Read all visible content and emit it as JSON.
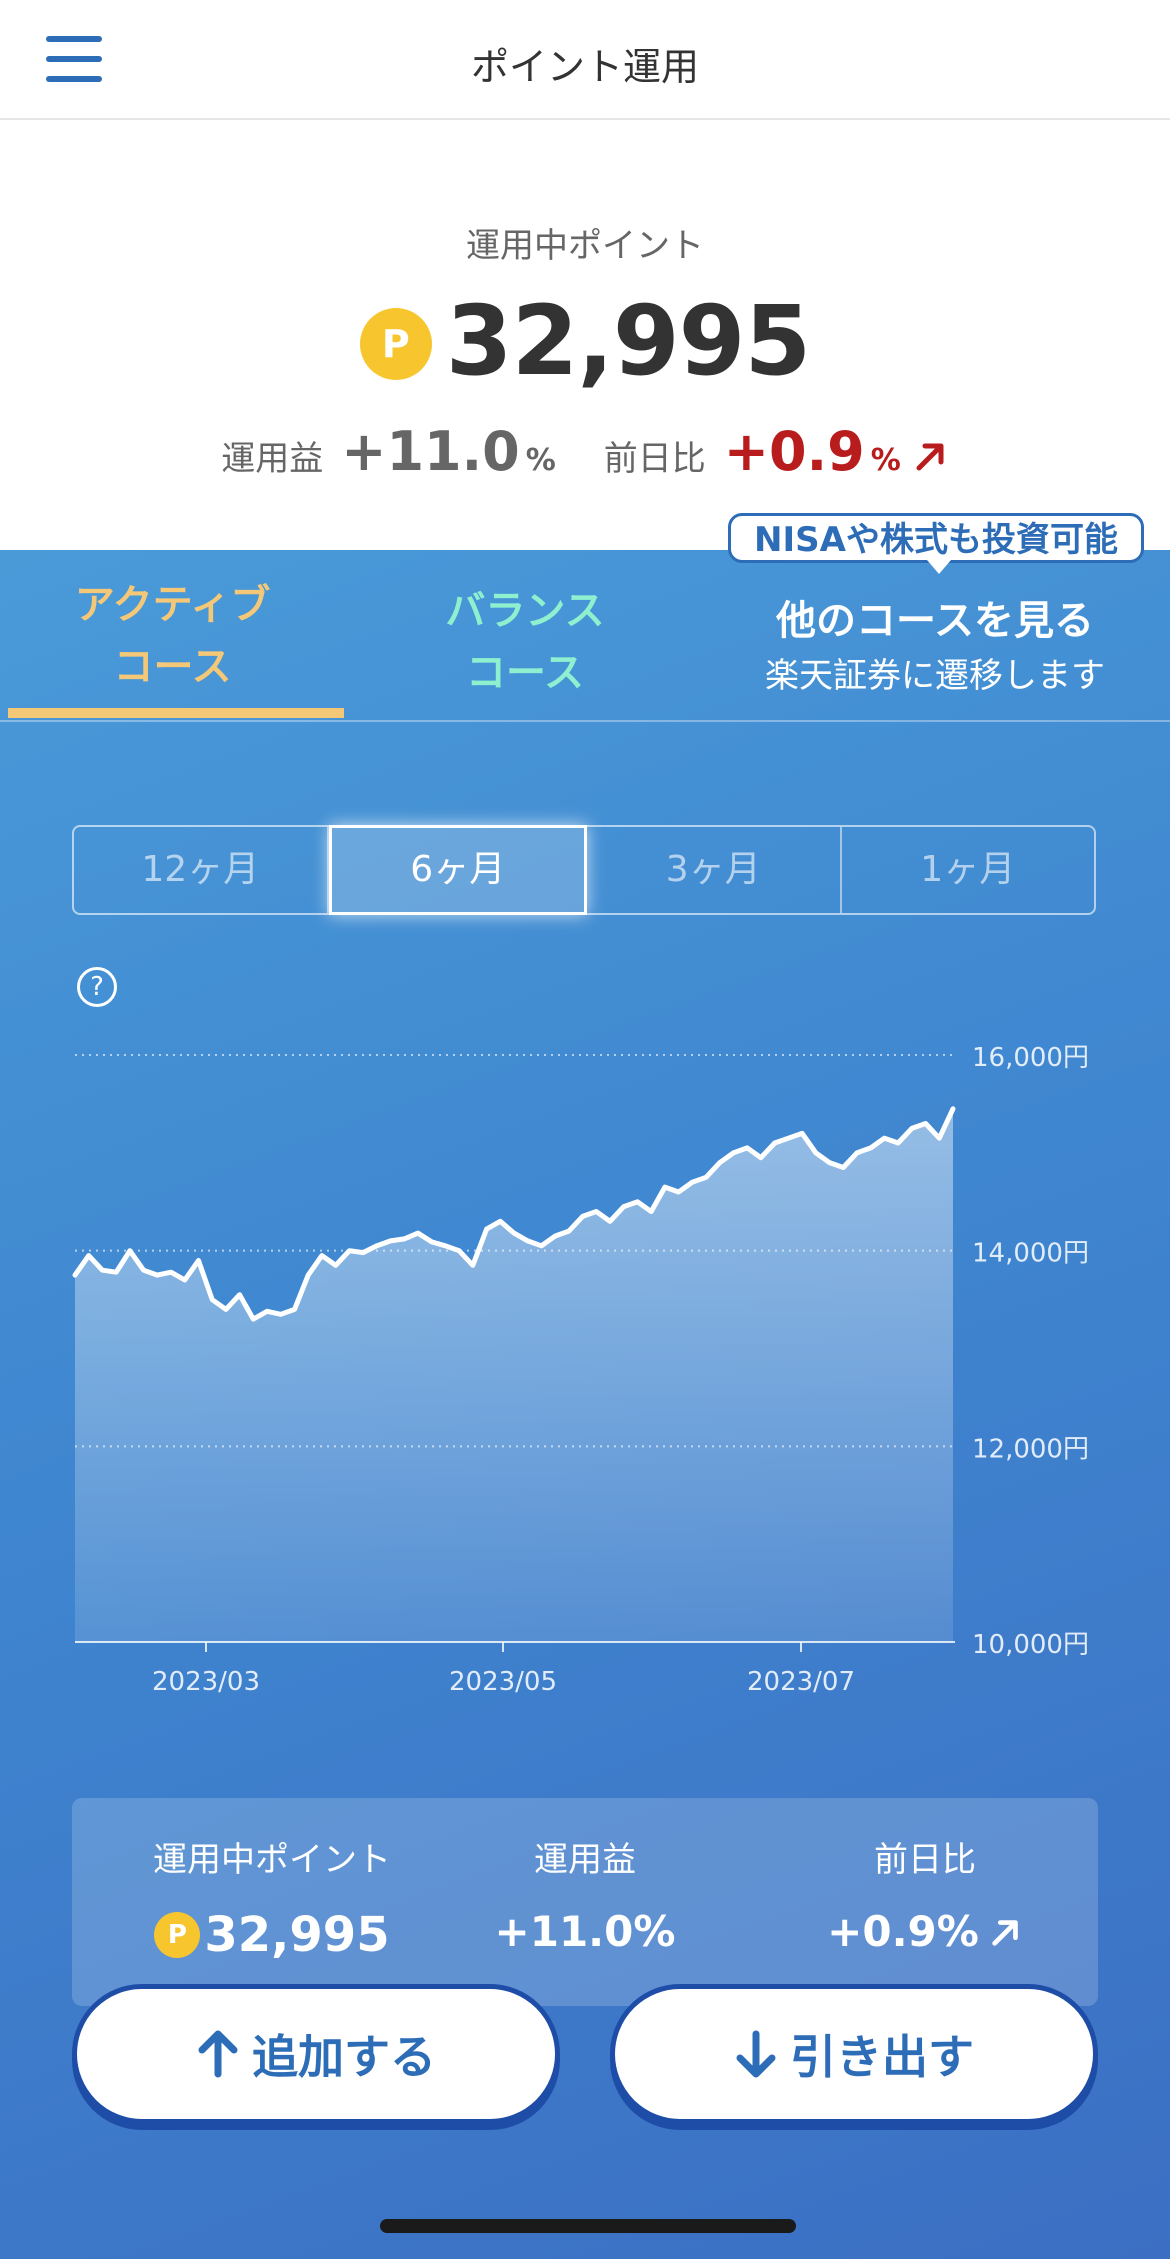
{
  "header": {
    "title": "ポイント運用"
  },
  "summary": {
    "label": "運用中ポイント",
    "coin": "P",
    "points": "32,995",
    "gain_label": "運用益",
    "gain_value": "+11.0",
    "gain_unit": "%",
    "day_label": "前日比",
    "day_value": "+0.9",
    "day_unit": "%"
  },
  "tabs": {
    "active_line1": "アクティブ",
    "active_line2": "コース",
    "balance_line1": "バランス",
    "balance_line2": "コース",
    "other_title": "他のコースを見る",
    "other_sub": "楽天証券に遷移します",
    "badge": "NISAや株式も投資可能"
  },
  "periods": [
    "12ヶ月",
    "6ヶ月",
    "3ヶ月",
    "1ヶ月"
  ],
  "selected_period": "6ヶ月",
  "chart_data": {
    "type": "area",
    "y_ticks": [
      "16,000円",
      "14,000円",
      "12,000円",
      "10,000円"
    ],
    "x_ticks": [
      "2023/03",
      "2023/05",
      "2023/07"
    ],
    "ylim": [
      10000,
      16000
    ],
    "grid": true,
    "series": [
      {
        "values": [
          13750,
          13950,
          13800,
          13780,
          14000,
          13800,
          13750,
          13780,
          13700,
          13900,
          13500,
          13400,
          13550,
          13300,
          13380,
          13350,
          13400,
          13750,
          13950,
          13850,
          14000,
          13980,
          14050,
          14100,
          14120,
          14180,
          14090,
          14050,
          14000,
          13850,
          14220,
          14300,
          14180,
          14100,
          14050,
          14150,
          14200,
          14350,
          14400,
          14300,
          14450,
          14500,
          14400,
          14650,
          14600,
          14700,
          14750,
          14900,
          15000,
          15050,
          14950,
          15100,
          15150,
          15200,
          15000,
          14900,
          14850,
          15000,
          15050,
          15150,
          15100,
          15250,
          15300,
          15150,
          15450
        ]
      }
    ]
  },
  "panel": {
    "points_label": "運用中ポイント",
    "coin": "P",
    "points": "32,995",
    "gain_label": "運用益",
    "gain_value": "+11.0%",
    "day_label": "前日比",
    "day_value": "+0.9%"
  },
  "actions": {
    "add": "追加する",
    "withdraw": "引き出す"
  },
  "colors": {
    "accent_blue": "#2d6cb6",
    "active_tab": "#f5c877",
    "balance_tab": "#8ef0cf",
    "up_red": "#b81c1c",
    "coin": "#f7c52e"
  }
}
